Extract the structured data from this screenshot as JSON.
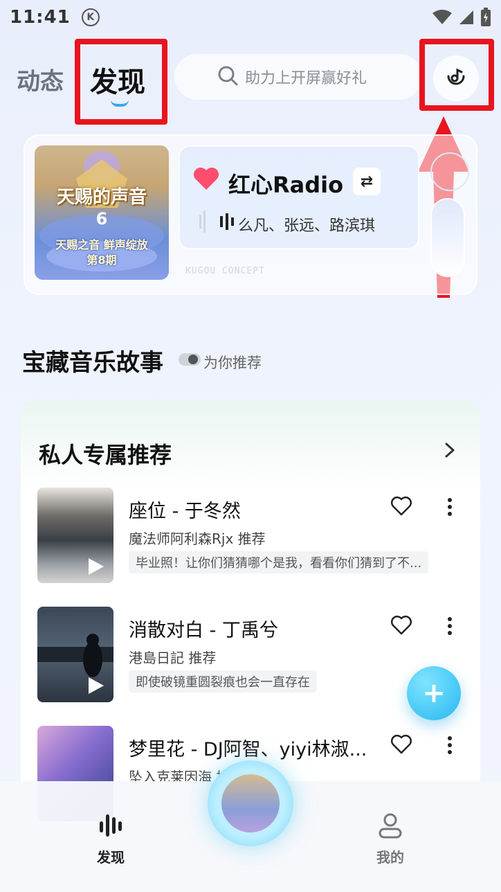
{
  "status_bar": {
    "time": "11:41",
    "k_badge": "K"
  },
  "header": {
    "tabs": [
      {
        "label": "动态"
      },
      {
        "label": "发现"
      }
    ],
    "search": {
      "placeholder": "助力上开屏赢好礼"
    }
  },
  "banner": {
    "cover": {
      "title": "天赐的声音",
      "number": "6",
      "subtitle": "天赐之音 鲜声绽放",
      "episode": "第8期"
    },
    "radio": {
      "title": "红心Radio",
      "artists": "么凡、张远、路滨琪"
    },
    "footer_text": "KUGOU CONCEPT"
  },
  "section": {
    "title": "宝藏音乐故事",
    "toggle_label": "为你推荐"
  },
  "recommend": {
    "title": "私人专属推荐",
    "songs": [
      {
        "title": "座位 - 于冬然",
        "recommender": "魔法师阿利森Rjx 推荐",
        "tag": "毕业照！让你们猜猜哪个是我，看看你们猜到了不..."
      },
      {
        "title": "消散对白 - 丁禹兮",
        "recommender": "港島日記 推荐",
        "tag": "即使破镜重圆裂痕也会一直存在"
      },
      {
        "title": "梦里花 - DJ阿智、yiyi林淑...",
        "recommender": "坠入克莱因海 推荐",
        "tag": ""
      }
    ]
  },
  "fab": {
    "label": "+"
  },
  "bottom_nav": {
    "discover": "发现",
    "mine": "我的"
  },
  "colors": {
    "accent": "#3aa5f0",
    "highlight_box": "#e8141f",
    "heart": "#ff4d6d",
    "fab": "#27b8f0"
  }
}
